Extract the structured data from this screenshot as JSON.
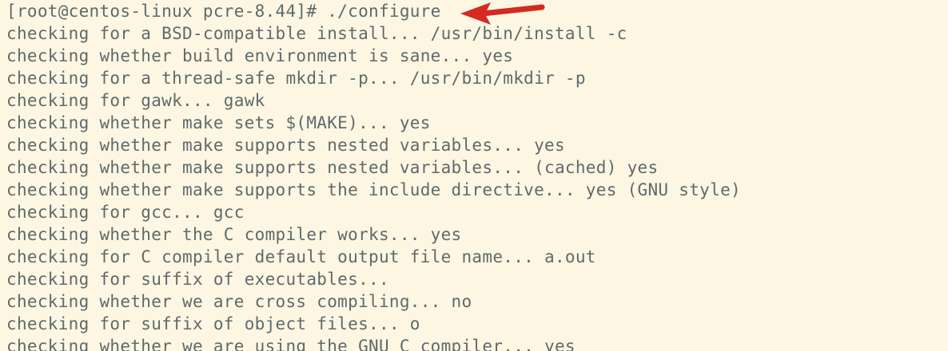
{
  "terminal": {
    "prompt": "[root@centos-linux pcre-8.44]# ./configure",
    "lines": [
      "checking for a BSD-compatible install... /usr/bin/install -c",
      "checking whether build environment is sane... yes",
      "checking for a thread-safe mkdir -p... /usr/bin/mkdir -p",
      "checking for gawk... gawk",
      "checking whether make sets $(MAKE)... yes",
      "checking whether make supports nested variables... yes",
      "checking whether make supports nested variables... (cached) yes",
      "checking whether make supports the include directive... yes (GNU style)",
      "checking for gcc... gcc",
      "checking whether the C compiler works... yes",
      "checking for C compiler default output file name... a.out",
      "checking for suffix of executables...",
      "checking whether we are cross compiling... no",
      "checking for suffix of object files... o",
      "checking whether we are using the GNU C compiler... yes"
    ]
  },
  "colors": {
    "background": "#fdf6e3",
    "text": "#5f6a6a",
    "annotation_arrow": "#d42a20"
  },
  "annotation": {
    "icon": "red-arrow-icon"
  }
}
